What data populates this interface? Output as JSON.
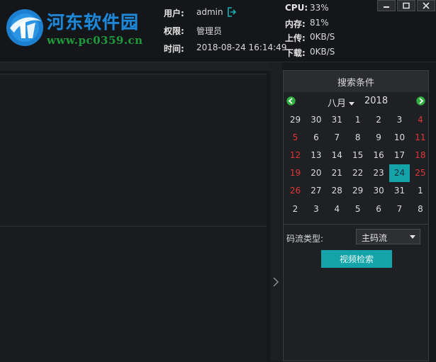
{
  "brand": {
    "title": "河东软件园",
    "url": "www.pc0359.cn"
  },
  "user_info": {
    "user_label": "用户:",
    "user_value": "admin",
    "perm_label": "权限:",
    "perm_value": "管理员",
    "time_label": "时间:",
    "time_value": "2018-08-24 16:14:49"
  },
  "stats": {
    "cpu_label": "CPU:",
    "cpu_value": "33%",
    "mem_label": "内存:",
    "mem_value": "81%",
    "up_label": "上传:",
    "up_value": "0KB/S",
    "down_label": "下载:",
    "down_value": "0KB/S"
  },
  "search_panel": {
    "title": "搜索条件",
    "month": "八月",
    "year": "2018",
    "calendar": [
      [
        29,
        30,
        31,
        1,
        2,
        3,
        4
      ],
      [
        5,
        6,
        7,
        8,
        9,
        10,
        11
      ],
      [
        12,
        13,
        14,
        15,
        16,
        17,
        18
      ],
      [
        19,
        20,
        21,
        22,
        23,
        24,
        25
      ],
      [
        26,
        27,
        28,
        29,
        30,
        31,
        1
      ],
      [
        2,
        3,
        4,
        5,
        6,
        7,
        8
      ]
    ],
    "selected_day": 24,
    "stream_type_label": "码流类型:",
    "stream_type_value": "主码流",
    "search_button": "视频检索"
  },
  "colors": {
    "accent": "#14a3a8",
    "weekend": "#e23636",
    "brand_blue": "#1f87d6",
    "brand_green": "#1e9a3c"
  },
  "icons": {
    "logout": "logout-icon",
    "prev_month": "arrow-left-icon",
    "next_month": "arrow-right-icon",
    "splitter": "chevron-right-icon"
  }
}
